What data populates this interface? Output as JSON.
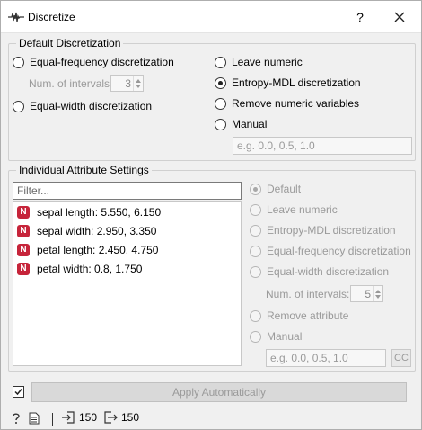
{
  "window": {
    "title": "Discretize",
    "help_label": "?"
  },
  "default_discretization": {
    "group_title": "Default Discretization",
    "options": [
      {
        "label": "Equal-frequency discretization",
        "checked": false
      },
      {
        "label": "Equal-width discretization",
        "checked": false
      },
      {
        "label": "Leave numeric",
        "checked": false
      },
      {
        "label": "Entropy-MDL discretization",
        "checked": true
      },
      {
        "label": "Remove numeric variables",
        "checked": false
      },
      {
        "label": "Manual",
        "checked": false
      }
    ],
    "intervals_label": "Num. of intervals:",
    "intervals_value": "3",
    "manual_placeholder": "e.g. 0.0, 0.5, 1.0"
  },
  "individual_settings": {
    "group_title": "Individual Attribute Settings",
    "filter_placeholder": "Filter...",
    "attributes": [
      {
        "icon": "N",
        "label": "sepal length: 5.550, 6.150"
      },
      {
        "icon": "N",
        "label": "sepal width: 2.950, 3.350"
      },
      {
        "icon": "N",
        "label": "petal length: 2.450, 4.750"
      },
      {
        "icon": "N",
        "label": "petal width: 0.8, 1.750"
      }
    ],
    "options": [
      {
        "label": "Default",
        "checked": true
      },
      {
        "label": "Leave numeric",
        "checked": false
      },
      {
        "label": "Entropy-MDL discretization",
        "checked": false
      },
      {
        "label": "Equal-frequency discretization",
        "checked": false
      },
      {
        "label": "Equal-width discretization",
        "checked": false
      },
      {
        "label": "Remove attribute",
        "checked": false
      },
      {
        "label": "Manual",
        "checked": false
      }
    ],
    "intervals_label": "Num. of intervals:",
    "intervals_value": "5",
    "manual_placeholder": "e.g. 0.0, 0.5, 1.0",
    "cc_label": "CC"
  },
  "apply": {
    "label": "Apply Automatically",
    "auto_checked": true
  },
  "status": {
    "input_count": "150",
    "output_count": "150"
  },
  "colors": {
    "attribute_icon": "#c6243a"
  }
}
